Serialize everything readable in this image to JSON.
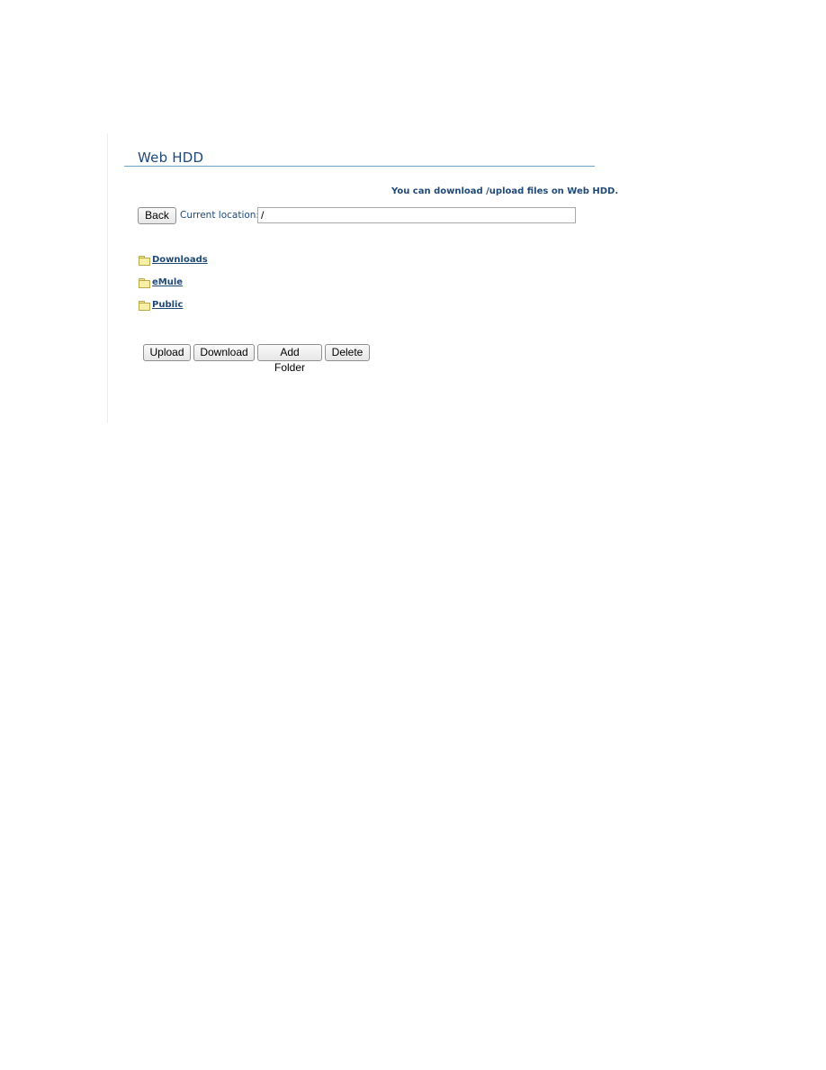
{
  "page": {
    "title": "Web HDD",
    "info_text": "You can download /upload files on Web HDD."
  },
  "location": {
    "back_label": "Back",
    "label": "Current location:",
    "value": "/"
  },
  "folders": [
    {
      "name": "Downloads",
      "icon": "folder-icon"
    },
    {
      "name": "eMule",
      "icon": "folder-icon"
    },
    {
      "name": "Public",
      "icon": "folder-icon"
    }
  ],
  "actions": {
    "upload": "Upload",
    "download": "Download",
    "add_folder": "Add Folder",
    "delete": "Delete"
  },
  "colors": {
    "accent": "#1f4a78",
    "rule": "#6fa3c8"
  }
}
